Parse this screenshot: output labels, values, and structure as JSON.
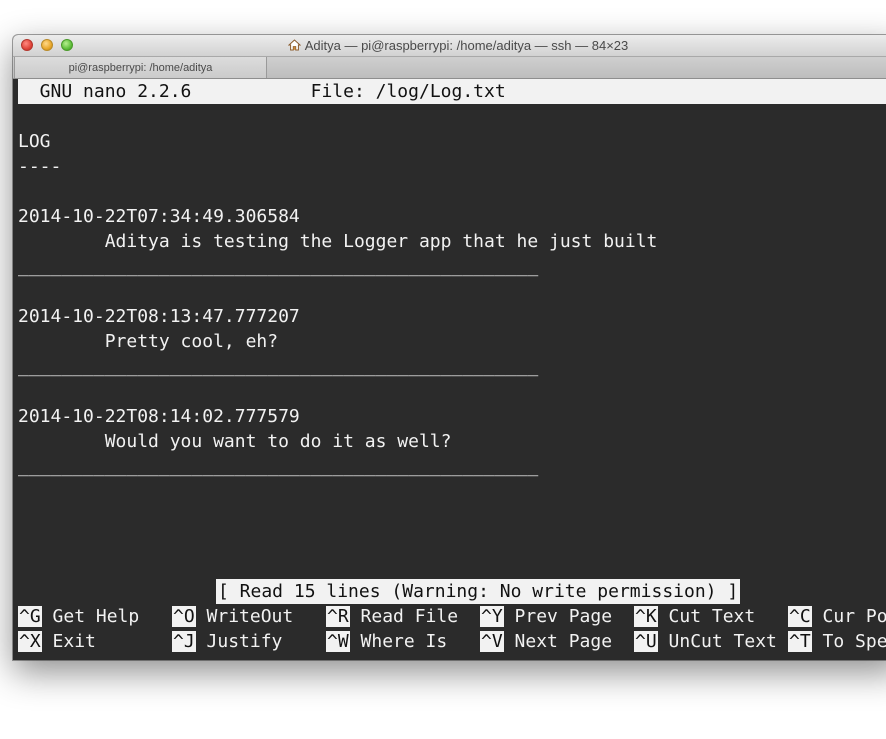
{
  "window": {
    "title": "Aditya — pi@raspberrypi: /home/aditya — ssh — 84×23",
    "tab_label": "pi@raspberrypi: /home/aditya"
  },
  "nano": {
    "version": "  GNU nano 2.2.6",
    "file": "File: /log/Log.txt"
  },
  "content": {
    "heading": "LOG",
    "underline": "----",
    "entries": [
      {
        "timestamp": "2014-10-22T07:34:49.306584",
        "message": "        Aditya is testing the Logger app that he just built"
      },
      {
        "timestamp": "2014-10-22T08:13:47.777207",
        "message": "        Pretty cool, eh?"
      },
      {
        "timestamp": "2014-10-22T08:14:02.777579",
        "message": "        Would you want to do it as well?"
      }
    ],
    "separator": "________________________________________________"
  },
  "status": "[ Read 15 lines (Warning: No write permission) ]",
  "shortcuts": {
    "row1": [
      {
        "key": "^G",
        "label": " Get Help"
      },
      {
        "key": "^O",
        "label": " WriteOut"
      },
      {
        "key": "^R",
        "label": " Read File"
      },
      {
        "key": "^Y",
        "label": " Prev Page"
      },
      {
        "key": "^K",
        "label": " Cut Text"
      },
      {
        "key": "^C",
        "label": " Cur Pos"
      }
    ],
    "row2": [
      {
        "key": "^X",
        "label": " Exit"
      },
      {
        "key": "^J",
        "label": " Justify"
      },
      {
        "key": "^W",
        "label": " Where Is"
      },
      {
        "key": "^V",
        "label": " Next Page"
      },
      {
        "key": "^U",
        "label": " UnCut Text"
      },
      {
        "key": "^T",
        "label": " To Spell"
      }
    ]
  },
  "colors": {
    "terminal_bg": "#2b2b2b",
    "terminal_fg": "#f2f2f2",
    "highlight_bg": "#f2f2f2"
  }
}
